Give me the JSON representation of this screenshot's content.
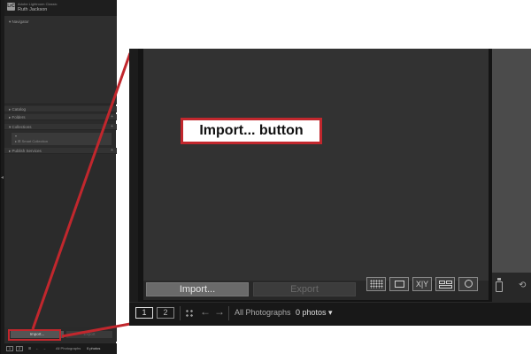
{
  "sidebar_mini": {
    "app_name": "Adobe Lightroom Classic",
    "user_name": "Ruth Jackson",
    "logo_text": "LrC",
    "panels": [
      "Navigator",
      "Catalog",
      "Folders",
      "Collections",
      "Publish Services"
    ],
    "collection_item": "Smart Collection",
    "import_label": "Import...",
    "export_label": "Export",
    "filmstrip": {
      "page_1": "1",
      "page_2": "2",
      "source": "All Photographs",
      "count": "0 photos"
    }
  },
  "zoom": {
    "import_label": "Import...",
    "export_label": "Export",
    "xy_label": "X|Y",
    "filmstrip": {
      "page_1": "1",
      "page_2": "2",
      "arrow_left": "←",
      "arrow_right": "→",
      "source": "All Photographs",
      "count": "0 photos ▾"
    }
  },
  "callout": {
    "text": "Import... button"
  },
  "colors": {
    "highlight": "#c1272d"
  },
  "icons": [
    "grid-view-icon",
    "loupe-view-icon",
    "compare-view-icon",
    "survey-view-icon",
    "people-view-icon",
    "spray-can-icon",
    "back-arrow-icon",
    "forward-arrow-icon"
  ]
}
